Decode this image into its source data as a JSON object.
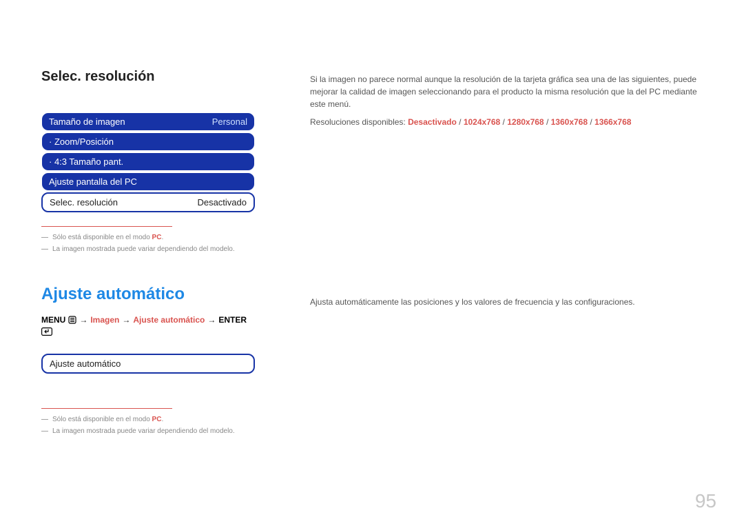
{
  "section1": {
    "heading": "Selec. resolución",
    "menu": [
      {
        "label": "Tamaño de imagen",
        "value": "Personal",
        "type": "blue"
      },
      {
        "label": "· Zoom/Posición",
        "value": "",
        "type": "blue"
      },
      {
        "label": "· 4:3 Tamaño pant.",
        "value": "",
        "type": "blue"
      },
      {
        "label": "Ajuste pantalla del PC",
        "value": "",
        "type": "blue"
      },
      {
        "label": "Selec. resolución",
        "value": "Desactivado",
        "type": "highlight"
      }
    ],
    "footnotes": [
      {
        "prefix": "Sólo está disponible en el modo ",
        "red": "PC",
        "suffix": "."
      },
      {
        "prefix": "La imagen mostrada puede variar dependiendo del modelo.",
        "red": "",
        "suffix": ""
      }
    ],
    "body": "Si la imagen no parece normal aunque la resolución de la tarjeta gráfica sea una de las siguientes, puede mejorar la calidad de imagen seleccionando para el producto la misma resolución que la del PC mediante este menú.",
    "res_label": "Resoluciones disponibles: ",
    "resolutions": [
      "Desactivado",
      "1024x768",
      "1280x768",
      "1360x768",
      "1366x768"
    ]
  },
  "section2": {
    "heading": "Ajuste automático",
    "breadcrumb": {
      "menu": "MENU",
      "path1": "Imagen",
      "path2": "Ajuste automático",
      "enter": "ENTER"
    },
    "menu": [
      {
        "label": "Ajuste automático",
        "value": "",
        "type": "simple"
      }
    ],
    "footnotes": [
      {
        "prefix": "Sólo está disponible en el modo ",
        "red": "PC",
        "suffix": "."
      },
      {
        "prefix": "La imagen mostrada puede variar dependiendo del modelo.",
        "red": "",
        "suffix": ""
      }
    ],
    "body": "Ajusta automáticamente las posiciones y los valores de frecuencia y las configuraciones."
  },
  "page_number": "95"
}
